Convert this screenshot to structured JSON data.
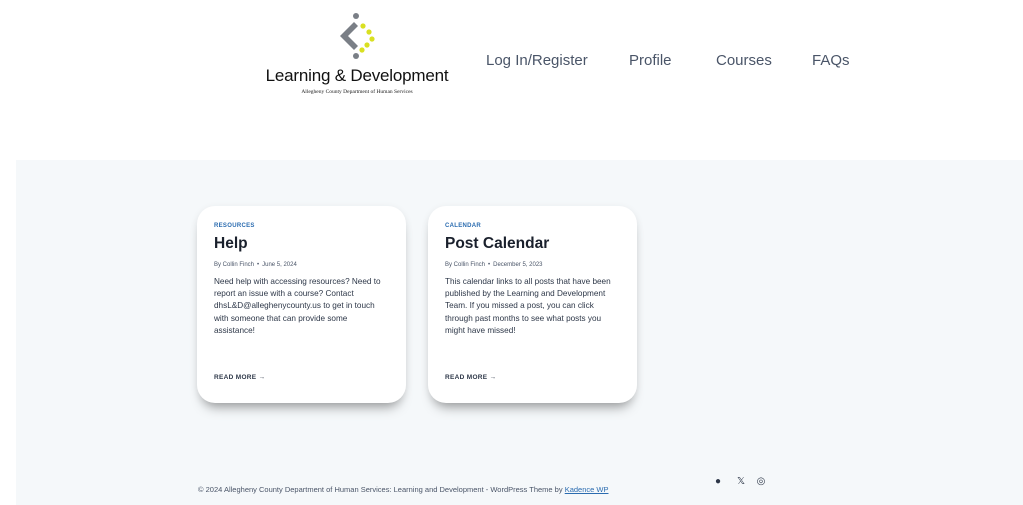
{
  "header": {
    "logo_title": "Learning & Development",
    "logo_subtitle": "Allegheny County Department of Human Services",
    "nav": [
      "Log In/Register",
      "Profile",
      "Courses",
      "FAQs"
    ]
  },
  "posts": [
    {
      "category": "RESOURCES",
      "title": "Help",
      "author": "By Collin Finch",
      "date": "June 5, 2024",
      "excerpt": "Need help with accessing resources? Need to report an issue with a course? Contact dhsL&D@alleghenycounty.us to get in touch with someone that can provide some assistance!",
      "read_more": "READ MORE →"
    },
    {
      "category": "CALENDAR",
      "title": "Post Calendar",
      "author": "By Collin Finch",
      "date": "December 5, 2023",
      "excerpt": "This calendar links to all posts that have been published by the Learning and Development Team. If you missed a post, you can click through past months to see what posts you might have missed!",
      "read_more": "READ MORE →"
    }
  ],
  "footer": {
    "copyright": "© 2024 Allegheny County Department of Human Services: Learning and Development - WordPress Theme by ",
    "theme_link": "Kadence WP",
    "social": [
      {
        "icon": "github-icon",
        "glyph": "●"
      },
      {
        "icon": "x-icon",
        "glyph": "𝕏"
      },
      {
        "icon": "instagram-icon",
        "glyph": "◎"
      }
    ]
  },
  "colors": {
    "accent": "#2b6cb0",
    "logo_gray": "#7a7f86",
    "logo_yellow": "#d9e021",
    "background": "#f5f8fa"
  }
}
